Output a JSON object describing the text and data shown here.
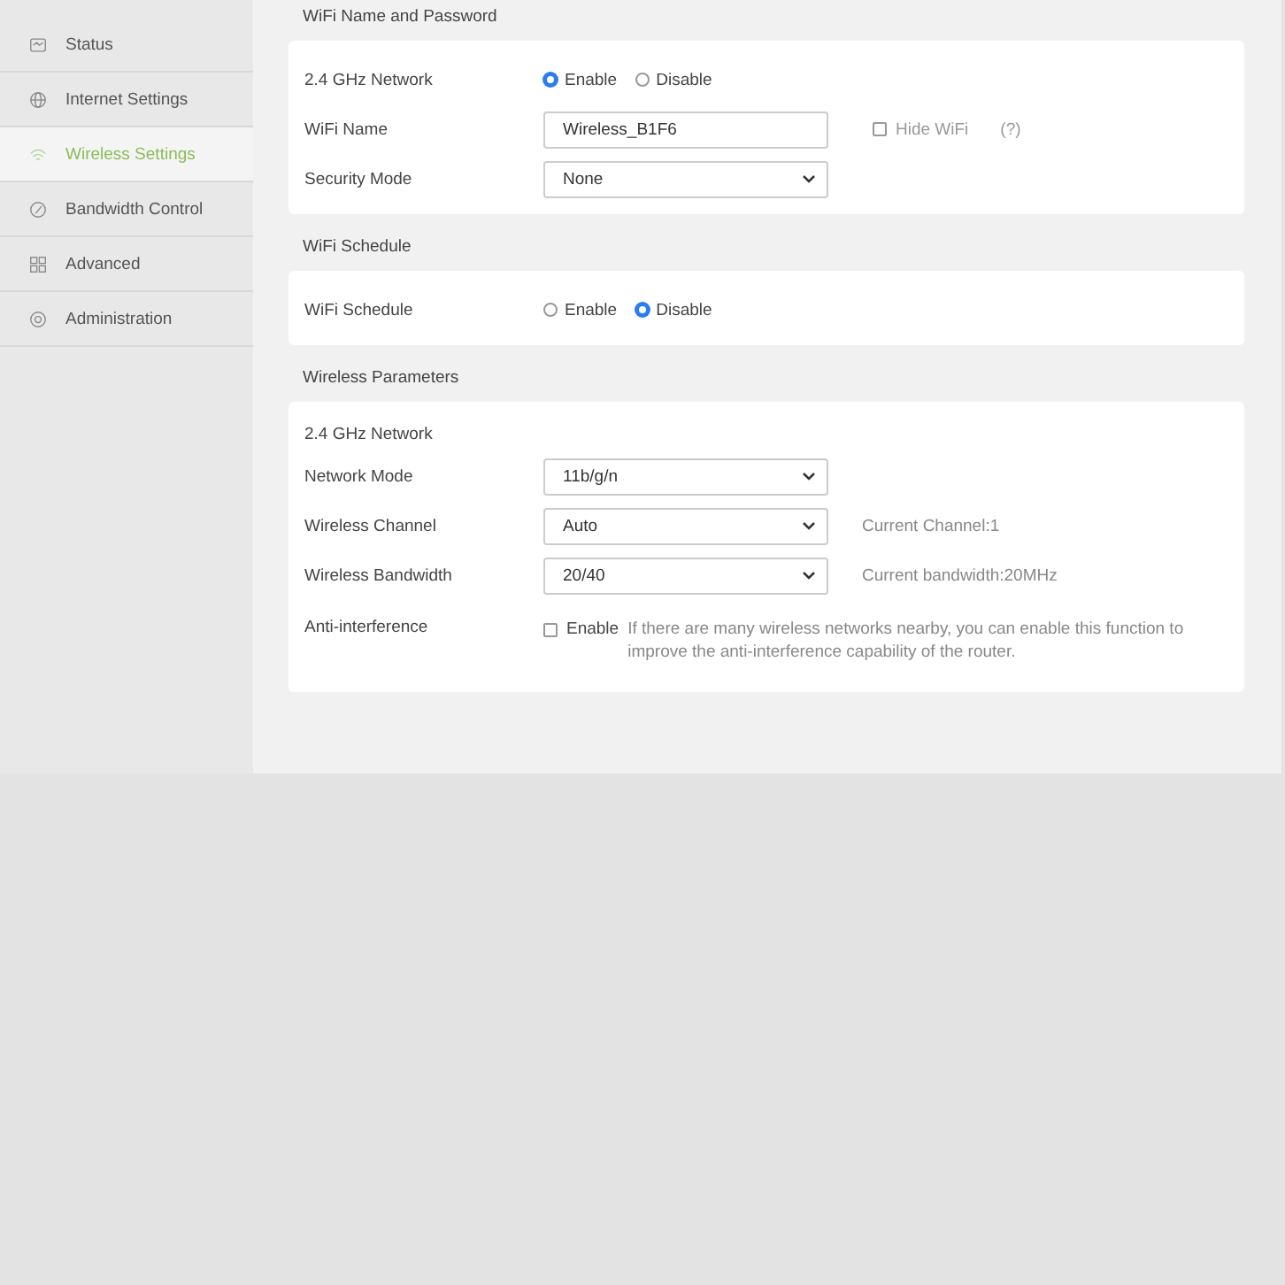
{
  "sidebar": {
    "items": [
      {
        "label": "Status",
        "selected": false
      },
      {
        "label": "Internet Settings",
        "selected": false
      },
      {
        "label": "Wireless Settings",
        "selected": true
      },
      {
        "label": "Bandwidth Control",
        "selected": false
      },
      {
        "label": "Advanced",
        "selected": false
      },
      {
        "label": "Administration",
        "selected": false
      }
    ]
  },
  "sections": [
    {
      "title": "WiFi Name and Password",
      "rows": [
        {
          "kind": "radio",
          "label": "2.4 GHz Network",
          "options": [
            {
              "label": "Enable",
              "selected": true
            },
            {
              "label": "Disable",
              "selected": false
            }
          ]
        },
        {
          "kind": "text",
          "label": "WiFi Name",
          "value": "Wireless_B1F6",
          "option": {
            "label": "Hide WiFi",
            "checked": false
          },
          "help": "(?)"
        },
        {
          "kind": "select",
          "label": "Security Mode",
          "value": "None"
        }
      ]
    },
    {
      "title": "WiFi Schedule",
      "rows": [
        {
          "kind": "radio",
          "label": "WiFi Schedule",
          "options": [
            {
              "label": "Enable",
              "selected": false
            },
            {
              "label": "Disable",
              "selected": true
            }
          ]
        }
      ]
    },
    {
      "title": "Wireless Parameters",
      "rows": [
        {
          "kind": "heading",
          "label": "2.4 GHz Network"
        },
        {
          "kind": "select",
          "label": "Network Mode",
          "value": "11b/g/n"
        },
        {
          "kind": "select",
          "label": "Wireless Channel",
          "value": "Auto",
          "note": "Current Channel:1"
        },
        {
          "kind": "select",
          "label": "Wireless Bandwidth",
          "value": "20/40",
          "note": "Current bandwidth:20MHz"
        },
        {
          "kind": "checkbox",
          "label": "Anti-interference",
          "option": {
            "label": "Enable",
            "checked": false
          },
          "description": "If there are many wireless networks nearby, you can enable this function to improve the anti-interference capability of the router."
        }
      ]
    }
  ]
}
